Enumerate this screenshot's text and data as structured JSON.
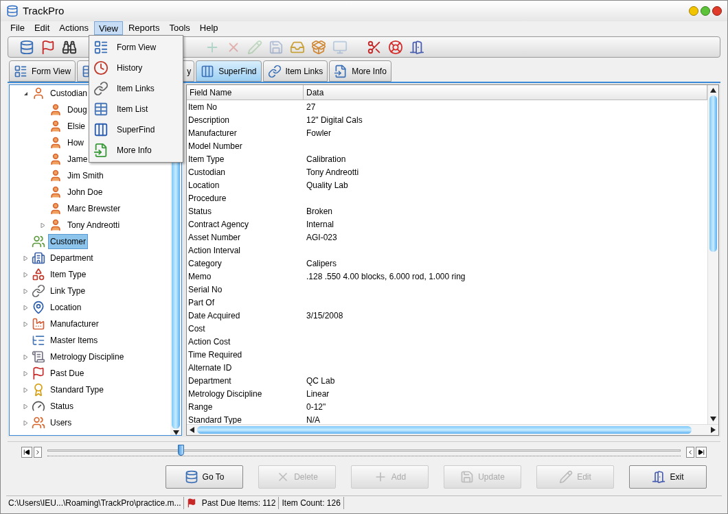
{
  "window": {
    "title": "TrackPro"
  },
  "menu_bar": [
    {
      "label": "File",
      "selected": false
    },
    {
      "label": "Edit",
      "selected": false
    },
    {
      "label": "Actions",
      "selected": false
    },
    {
      "label": "View",
      "selected": true
    },
    {
      "label": "Reports",
      "selected": false
    },
    {
      "label": "Tools",
      "selected": false
    },
    {
      "label": "Help",
      "selected": false
    }
  ],
  "view_menu": [
    {
      "label": "Form View"
    },
    {
      "label": "History"
    },
    {
      "label": "Item Links"
    },
    {
      "label": "Item List"
    },
    {
      "label": "SuperFind"
    },
    {
      "label": "More Info"
    }
  ],
  "toolbar": [
    {
      "disabled": false
    },
    {
      "disabled": false
    },
    {
      "disabled": false
    },
    {
      "disabled": true
    },
    {
      "disabled": true
    },
    {
      "disabled": true
    },
    {
      "disabled": true
    },
    {
      "disabled": false
    },
    {
      "disabled": false
    },
    {
      "disabled": true
    },
    {
      "disabled": false
    },
    {
      "disabled": false
    },
    {
      "disabled": false
    }
  ],
  "tabs": [
    {
      "label": "Form View",
      "selected": false
    },
    {
      "selected": false
    },
    {
      "label": "y",
      "selected": false
    },
    {
      "label": "SuperFind",
      "selected": true
    },
    {
      "label": "Item Links",
      "selected": false
    },
    {
      "label": "More Info",
      "selected": false
    }
  ],
  "tree": [
    {
      "label": "Custodian",
      "expanded": true,
      "selected": false,
      "children": [
        {
          "label": "Doug",
          "selected": false
        },
        {
          "label": "Elsie",
          "selected": false
        },
        {
          "label": "How",
          "selected": false
        },
        {
          "label": "Jame",
          "selected": false
        },
        {
          "label": "Jim Smith",
          "selected": false
        },
        {
          "label": "John Doe",
          "selected": false
        },
        {
          "label": "Marc Brewster",
          "selected": false
        },
        {
          "label": "Tony Andreotti",
          "expanded": false,
          "selected": false
        }
      ]
    },
    {
      "label": "Customer",
      "selected": true
    },
    {
      "label": "Department",
      "expanded": false,
      "selected": false
    },
    {
      "label": "Item Type",
      "expanded": false,
      "selected": false
    },
    {
      "label": "Link Type",
      "expanded": false,
      "selected": false
    },
    {
      "label": "Location",
      "expanded": false,
      "selected": false
    },
    {
      "label": "Manufacturer",
      "expanded": false,
      "selected": false
    },
    {
      "label": "Master Items",
      "selected": false
    },
    {
      "label": "Metrology Discipline",
      "expanded": false,
      "selected": false
    },
    {
      "label": "Past Due",
      "expanded": false,
      "selected": false
    },
    {
      "label": "Standard Type",
      "expanded": false,
      "selected": false
    },
    {
      "label": "Status",
      "expanded": false,
      "selected": false
    },
    {
      "label": "Users",
      "expanded": false,
      "selected": false
    }
  ],
  "table": {
    "columns": [
      "Field Name",
      "Data"
    ],
    "rows": [
      [
        "Item No",
        "27"
      ],
      [
        "Description",
        "12\" Digital Cals"
      ],
      [
        "Manufacturer",
        "Fowler"
      ],
      [
        "Model Number",
        ""
      ],
      [
        "Item Type",
        "Calibration"
      ],
      [
        "Custodian",
        "Tony Andreotti"
      ],
      [
        "Location",
        "Quality Lab"
      ],
      [
        "Procedure",
        ""
      ],
      [
        "Status",
        "Broken"
      ],
      [
        "Contract Agency",
        "Internal"
      ],
      [
        "Asset Number",
        "AGI-023"
      ],
      [
        "Action Interval",
        ""
      ],
      [
        "Category",
        "Calipers"
      ],
      [
        "Memo",
        ".128 .550 4.00 blocks, 6.000 rod, 1.000 ring"
      ],
      [
        "Serial No",
        ""
      ],
      [
        "Part Of",
        ""
      ],
      [
        "Date Acquired",
        "3/15/2008"
      ],
      [
        "Cost",
        ""
      ],
      [
        "Action Cost",
        ""
      ],
      [
        "Time Required",
        ""
      ],
      [
        "Alternate ID",
        ""
      ],
      [
        "Department",
        "QC Lab"
      ],
      [
        "Metrology Discipline",
        "Linear"
      ],
      [
        "Range",
        "0-12\""
      ],
      [
        "Standard Type",
        "N/A"
      ]
    ]
  },
  "navigator": {
    "level": 0.21
  },
  "action_buttons": [
    {
      "label": "Go To",
      "disabled": false
    },
    {
      "label": "Delete",
      "disabled": true
    },
    {
      "label": "Add",
      "disabled": true
    },
    {
      "label": "Update",
      "disabled": true
    },
    {
      "label": "Edit",
      "disabled": true
    },
    {
      "label": "Exit",
      "disabled": false
    }
  ],
  "status_bar": {
    "path": "C:\\Users\\IEU...\\Roaming\\TrackPro\\practice.m...",
    "past_due": "Past Due Items: 112",
    "item_count": "Item Count: 126"
  }
}
